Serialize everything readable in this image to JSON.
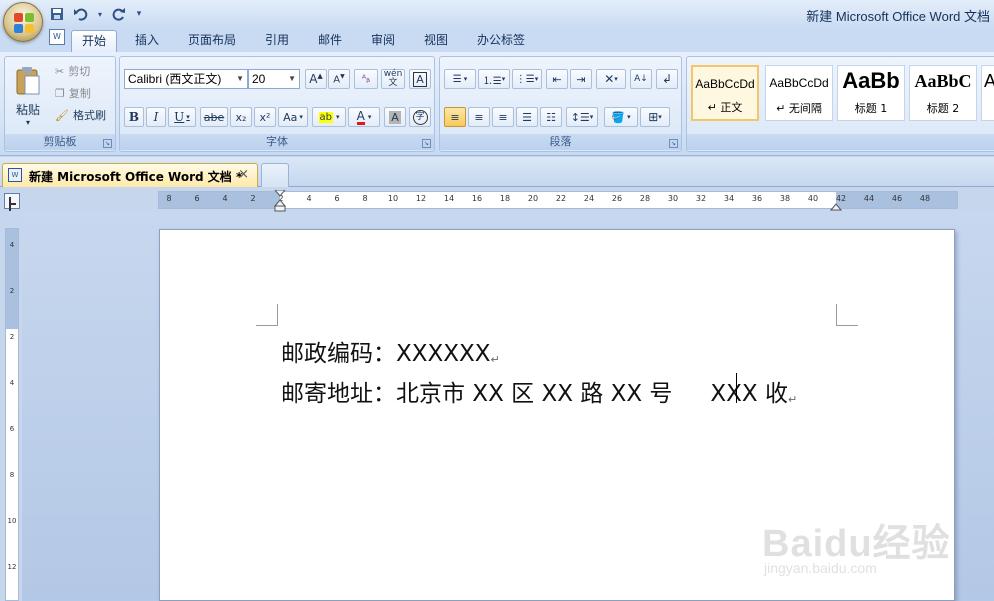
{
  "window": {
    "title": "新建 Microsoft Office Word 文档"
  },
  "qat": {
    "save_icon": "save-icon",
    "undo_icon": "undo-icon",
    "redo_icon": "redo-icon"
  },
  "tabs": [
    "开始",
    "插入",
    "页面布局",
    "引用",
    "邮件",
    "审阅",
    "视图",
    "办公标签"
  ],
  "ribbon": {
    "clipboard": {
      "label": "剪贴板",
      "paste": "粘贴",
      "cut": "剪切",
      "copy": "复制",
      "format_painter": "格式刷"
    },
    "font": {
      "label": "字体",
      "font_name": "Calibri (西文正文)",
      "font_size": "20",
      "phonetic": "wén",
      "bold": "B",
      "italic": "I",
      "underline": "U",
      "strike": "abe",
      "subscript": "x₂",
      "superscript": "x²",
      "change_case": "Aa"
    },
    "paragraph": {
      "label": "段落"
    },
    "styles": [
      {
        "sample": "AaBbCcDd",
        "name": "↵ 正文"
      },
      {
        "sample": "AaBbCcDd",
        "name": "↵ 无间隔"
      },
      {
        "sample": "AaBb",
        "name": "标题 1"
      },
      {
        "sample": "AaBbC",
        "name": "标题 2"
      }
    ]
  },
  "document_tab": {
    "label": "新建 Microsoft Office Word 文档 *",
    "close": "×"
  },
  "ruler": {
    "h_numbers": [
      "8",
      "6",
      "4",
      "2",
      "2",
      "4",
      "6",
      "8",
      "10",
      "12",
      "14",
      "16",
      "18",
      "20",
      "22",
      "24",
      "26",
      "28",
      "30",
      "32",
      "34",
      "36",
      "38",
      "40",
      "42",
      "44",
      "46",
      "48"
    ],
    "v_numbers": [
      "4",
      "2",
      "2",
      "4",
      "6",
      "8",
      "10",
      "12"
    ]
  },
  "document": {
    "line1": "邮政编码：XXXXXX",
    "line2_a": "邮寄地址：北京市 XX 区 XX 路 XX 号",
    "line2_b": "XXX 收",
    "paragraph_mark": "↵"
  },
  "watermark": {
    "big": "Baidu经验",
    "small": "jingyan.baidu.com"
  }
}
